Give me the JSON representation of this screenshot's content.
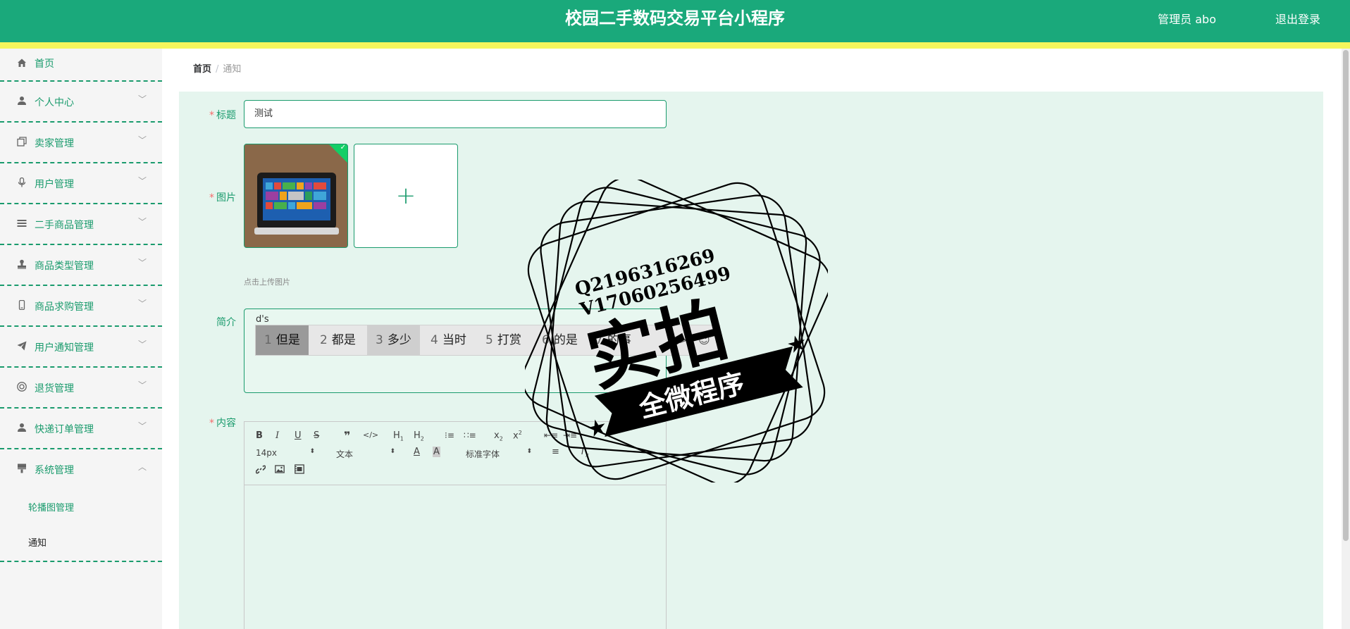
{
  "header": {
    "title": "校园二手数码交易平台小程序",
    "admin": "管理员 abo",
    "logout": "退出登录",
    "bg_color": "#1aa97b",
    "strip_color": "#f5f65c"
  },
  "sidebar": {
    "items": [
      {
        "label": "首页",
        "icon": "home-icon"
      },
      {
        "label": "个人中心",
        "icon": "user-icon"
      },
      {
        "label": "卖家管理",
        "icon": "copy-icon"
      },
      {
        "label": "用户管理",
        "icon": "microphone-icon"
      },
      {
        "label": "二手商品管理",
        "icon": "list-icon"
      },
      {
        "label": "商品类型管理",
        "icon": "stamp-icon"
      },
      {
        "label": "商品求购管理",
        "icon": "phone-icon"
      },
      {
        "label": "用户通知管理",
        "icon": "send-icon"
      },
      {
        "label": "退货管理",
        "icon": "help-icon"
      },
      {
        "label": "快递订单管理",
        "icon": "person-icon"
      },
      {
        "label": "系统管理",
        "icon": "brush-icon"
      }
    ],
    "sub_items": [
      "轮播图管理",
      "通知"
    ]
  },
  "breadcrumb": {
    "home": "首页",
    "separator": "/",
    "current": "通知"
  },
  "form": {
    "title_label": "标题",
    "title_value": "测试",
    "image_label": "图片",
    "upload_hint": "点击上传图片",
    "intro_label": "简介",
    "intro_value": "d's",
    "content_label": "内容"
  },
  "ime": {
    "candidates": [
      {
        "n": "1",
        "text": "但是"
      },
      {
        "n": "2",
        "text": "都是"
      },
      {
        "n": "3",
        "text": "多少"
      },
      {
        "n": "4",
        "text": "当时"
      },
      {
        "n": "5",
        "text": "打赏"
      },
      {
        "n": "6",
        "text": "的是"
      },
      {
        "n": "7",
        "text": "的事"
      }
    ],
    "next": ">"
  },
  "editor": {
    "font_size": "14px",
    "block_type": "文本",
    "font_family": "标准字体"
  },
  "stamp": {
    "line1": "Q2196316269",
    "line2": "V17060256499",
    "big": "实拍",
    "banner": "全微程序"
  }
}
